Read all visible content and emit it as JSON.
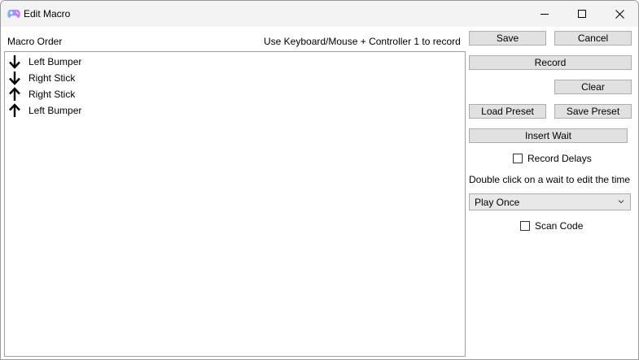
{
  "window": {
    "title": "Edit Macro"
  },
  "labels": {
    "macro_order": "Macro Order",
    "instructions": "Use Keyboard/Mouse + Controller 1 to record",
    "double_click_hint": "Double click on a wait to edit the time"
  },
  "macro_items": [
    {
      "direction": "down",
      "label": "Left Bumper"
    },
    {
      "direction": "down",
      "label": "Right Stick"
    },
    {
      "direction": "up",
      "label": "Right Stick"
    },
    {
      "direction": "up",
      "label": "Left Bumper"
    }
  ],
  "buttons": {
    "save": "Save",
    "cancel": "Cancel",
    "record": "Record",
    "clear": "Clear",
    "load_preset": "Load Preset",
    "save_preset": "Save Preset",
    "insert_wait": "Insert Wait"
  },
  "checkboxes": {
    "record_delays": {
      "label": "Record Delays",
      "checked": false
    },
    "scan_code": {
      "label": "Scan Code",
      "checked": false
    }
  },
  "play_mode": {
    "selected": "Play Once"
  },
  "colors": {
    "titlebar": "#f3f3f3",
    "button_face": "#e1e1e1",
    "button_border": "#adadad",
    "icon_gradient_start": "#6fb6ff",
    "icon_gradient_end": "#d66bff"
  }
}
